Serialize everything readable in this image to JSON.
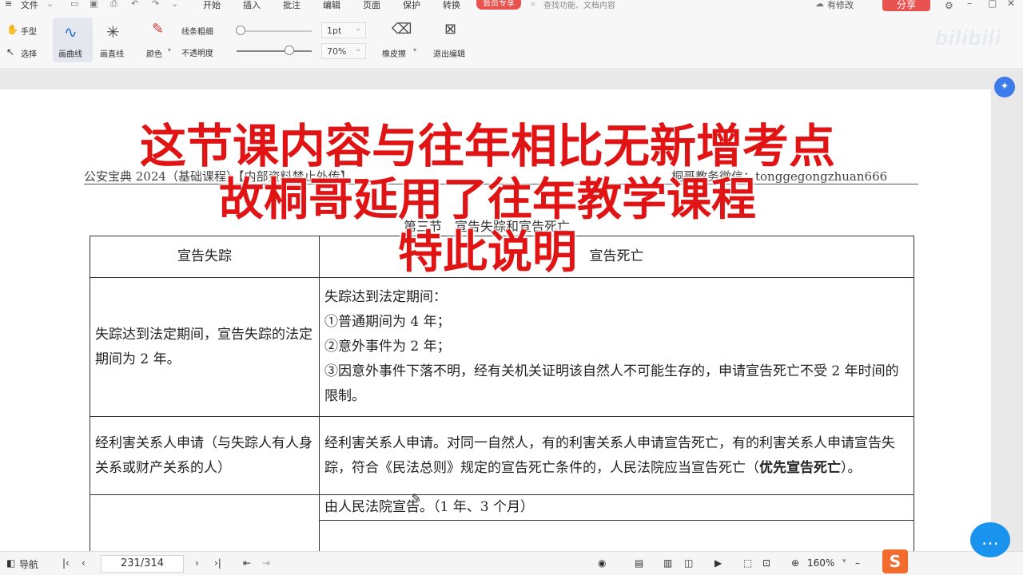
{
  "menubar": {
    "items": [
      "文件",
      "开始",
      "插入",
      "批注",
      "编辑",
      "页面",
      "保护",
      "转换"
    ],
    "member_label": "会员专享",
    "search_placeholder": "查找功能、文档内容",
    "status_text": "有修改",
    "share_label": "分享"
  },
  "ribbon": {
    "hand_label": "手型",
    "select_label": "选择",
    "curve_label": "画曲线",
    "line_label": "画直线",
    "color_label": "颜色",
    "thickness_label": "线条粗细",
    "opacity_label": "不透明度",
    "thickness_value": "1pt",
    "opacity_value": "70%",
    "eraser_label": "橡皮擦",
    "exit_label": "退出编辑",
    "opacity_level": 0.7,
    "thickness_level": 0.05
  },
  "document": {
    "header_left": "公安宝典 2024（基础课程）【内部资料禁止外传】",
    "header_right": "桐哥教务微信：tonggegongzhuan666",
    "section_title": "第三节　宣告失踪和宣告死亡",
    "table": {
      "col1_header": "宣告失踪",
      "col2_header": "宣告死亡",
      "row1_left": "失踪达到法定期间，宣告失踪的法定期间为 2 年。",
      "row1_right_lines": [
        "失踪达到法定期间：",
        "①普通期间为 4 年；",
        "②意外事件为 2 年；",
        "③因意外事件下落不明，经有关机关证明该自然人不可能生存的，申请宣告死亡不受 2 年时间的限制。"
      ],
      "row2_left": "经利害关系人申请（与失踪人有人身关系或财产关系的人）",
      "row2_right": "经利害关系人申请。对同一自然人，有的利害关系人申请宣告死亡，有的利害关系人申请宣告失踪，符合《民法总则》规定的宣告死亡条件的，人民法院应当宣告死亡（",
      "row2_right_bold": "优先宣告死亡",
      "row2_right_end": "）。",
      "row3_right": "由人民法院宣告。（1 年、3 个月）"
    }
  },
  "overlay": {
    "line1": "这节课内容与往年相比无新增考点",
    "line2": "故桐哥延用了往年教学课程",
    "line3": "特此说明"
  },
  "statusbar": {
    "nav_label": "导航",
    "page_indicator": "231/314",
    "zoom": "160%"
  },
  "colors": {
    "overlay_text": "#e01414",
    "accent_red": "#e8534f",
    "accent_blue": "#3d7bea"
  }
}
